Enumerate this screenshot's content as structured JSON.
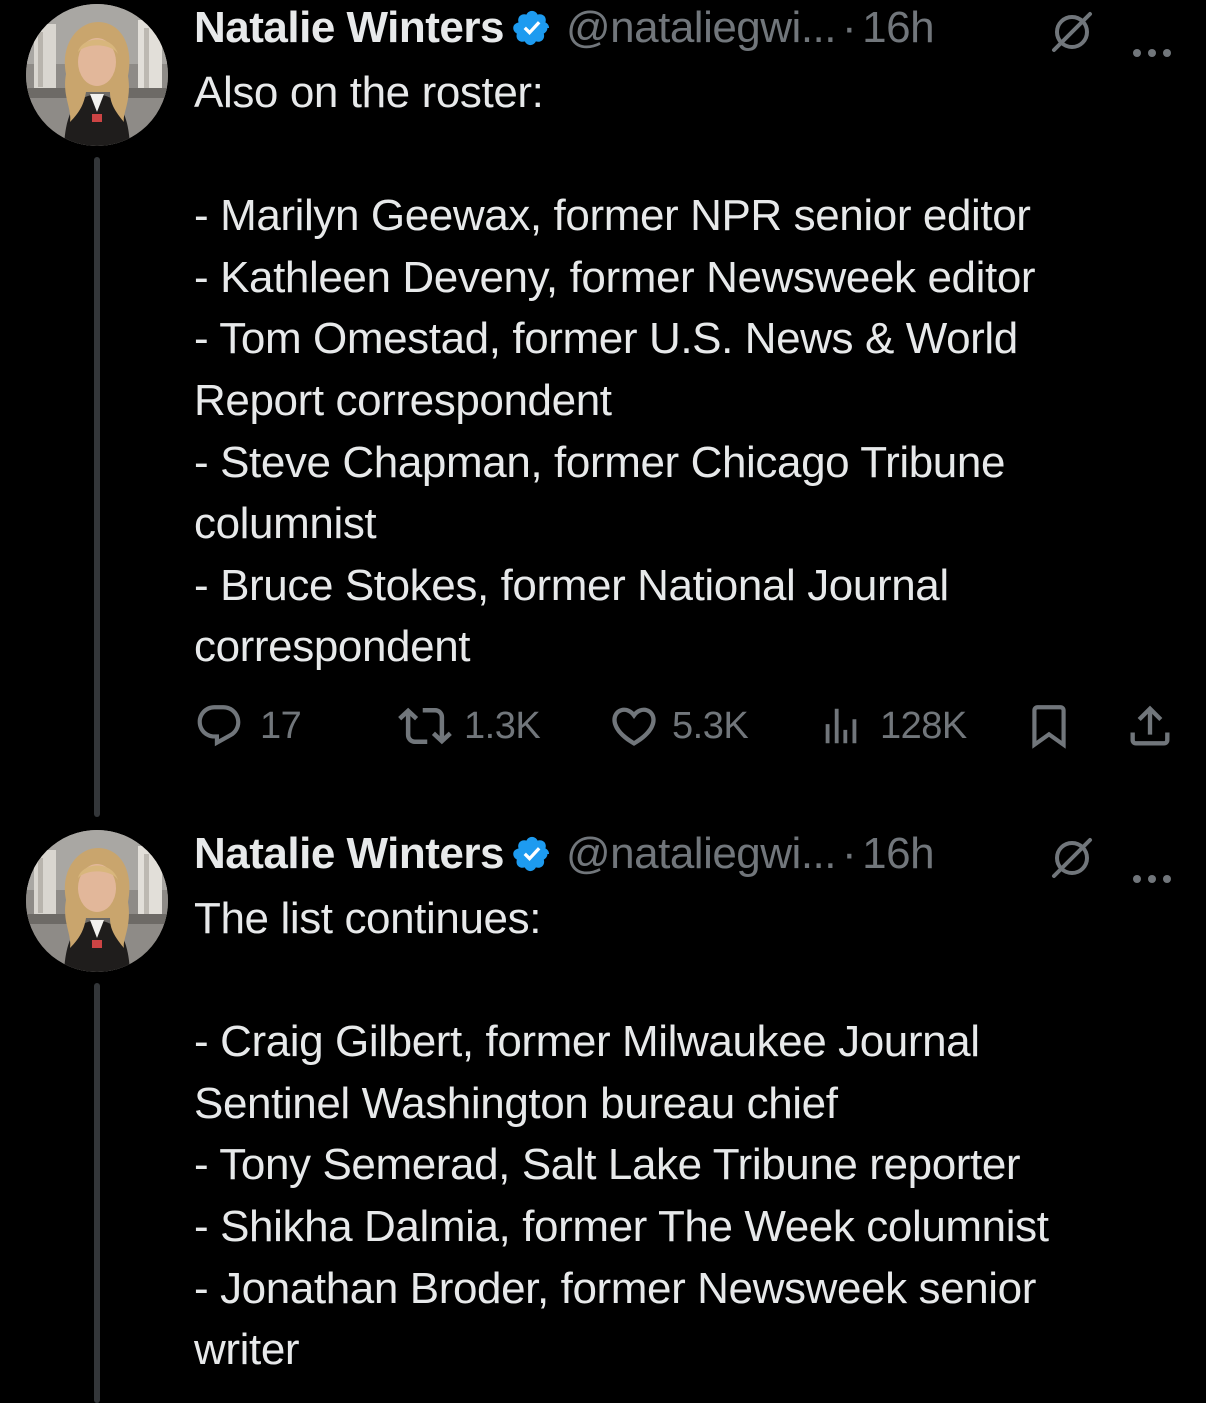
{
  "tweets": [
    {
      "author_name": "Natalie Winters",
      "handle": "@nataliegwi...",
      "separator": "·",
      "time": "16h",
      "text_lines": [
        "Also on the roster:",
        "",
        "- Marilyn Geewax, former NPR senior editor",
        "- Kathleen Deveny, former Newsweek editor",
        "- Tom Omestad, former U.S. News & World",
        "Report correspondent",
        "- Steve Chapman, former Chicago Tribune",
        "columnist",
        "- Bruce Stokes, former National Journal",
        "correspondent"
      ],
      "stats": {
        "replies": "17",
        "reposts": "1.3K",
        "likes": "5.3K",
        "views": "128K"
      },
      "icons": {
        "verified": "verified-badge-icon",
        "mute": "muted-conversation-icon",
        "more": "more-options-icon",
        "reply": "reply-icon",
        "repost": "repost-icon",
        "like": "like-icon",
        "views": "views-icon",
        "bookmark": "bookmark-icon",
        "share": "share-icon"
      }
    },
    {
      "author_name": "Natalie Winters",
      "handle": "@nataliegwi...",
      "separator": "·",
      "time": "16h",
      "text_lines": [
        "The list continues:",
        "",
        "- Craig Gilbert, former Milwaukee Journal",
        "Sentinel Washington bureau chief",
        "- Tony Semerad, Salt Lake Tribune reporter",
        "- Shikha Dalmia, former The Week columnist",
        "- Jonathan Broder, former Newsweek senior",
        "writer"
      ],
      "icons": {
        "verified": "verified-badge-icon",
        "mute": "muted-conversation-icon",
        "more": "more-options-icon"
      }
    }
  ],
  "colors": {
    "background": "#000000",
    "primary_text": "#e7e9ea",
    "secondary_text": "#71767b",
    "verified_blue": "#1d9bf0",
    "thread_line": "#333639"
  }
}
